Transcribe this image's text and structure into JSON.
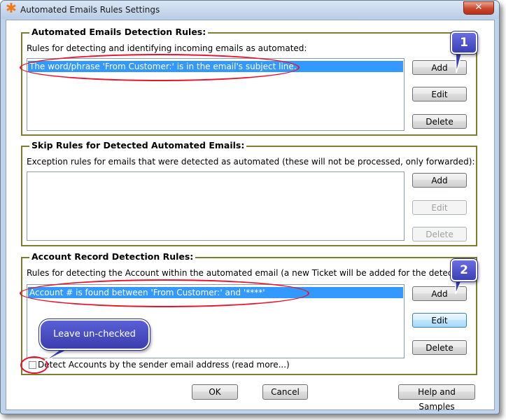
{
  "window": {
    "title": "Automated Emails Rules Settings",
    "close_label": "✕"
  },
  "detection": {
    "title": "Automated Emails Detection Rules:",
    "description": "Rules for detecting and identifying incoming emails as automated:",
    "items": [
      "The word/phrase 'From Customer:' is in the email's subject line."
    ],
    "add": "Add",
    "edit": "Edit",
    "delete": "Delete"
  },
  "skip": {
    "title": "Skip Rules for Detected Automated Emails:",
    "description": "Exception rules for emails that were detected as automated (these will not be processed, only forwarded):",
    "add": "Add",
    "edit": "Edit",
    "delete": "Delete"
  },
  "account": {
    "title": "Account Record Detection Rules:",
    "description": "Rules for detecting the Account within the automated email (a new Ticket will be added for the detected Acco",
    "items": [
      "Account # is found between 'From Customer:' and '****'"
    ],
    "add": "Add",
    "edit": "Edit",
    "delete": "Delete",
    "checkbox_label": "Detect Accounts by the sender email address",
    "checked": false,
    "read_more": "(read more...)"
  },
  "callouts": {
    "one": "1",
    "two": "2",
    "leave": "Leave un-checked"
  },
  "footer": {
    "ok": "OK",
    "cancel": "Cancel",
    "help": "Help and Samples"
  },
  "colors": {
    "selection": "#3399ff",
    "group_border": "#7c7d2f",
    "highlight_oval": "#e8132b",
    "callout": "#4a4ec8"
  }
}
